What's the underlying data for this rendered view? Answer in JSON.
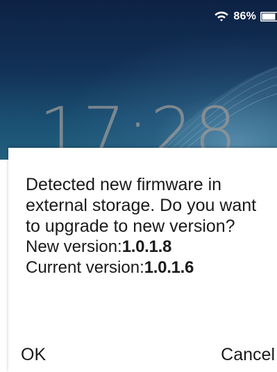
{
  "status_bar": {
    "wifi_icon": "wifi-icon",
    "battery_percent": "86%",
    "battery_icon": "battery-icon",
    "battery_level": 0.86
  },
  "lock_screen": {
    "time": "17:28"
  },
  "dialog": {
    "message": "Detected new firmware in external storage. Do you want to upgrade to new version?",
    "new_version_label": "New version:",
    "new_version_value": "1.0.1.8",
    "current_version_label": "Current version:",
    "current_version_value": "1.0.1.6",
    "ok_label": "OK",
    "cancel_label": "Cancel"
  },
  "colors": {
    "wallpaper_top": "#0d2244",
    "wallpaper_bottom": "#22607e",
    "dialog_background": "#ffffff",
    "text": "#1a1a1a"
  }
}
